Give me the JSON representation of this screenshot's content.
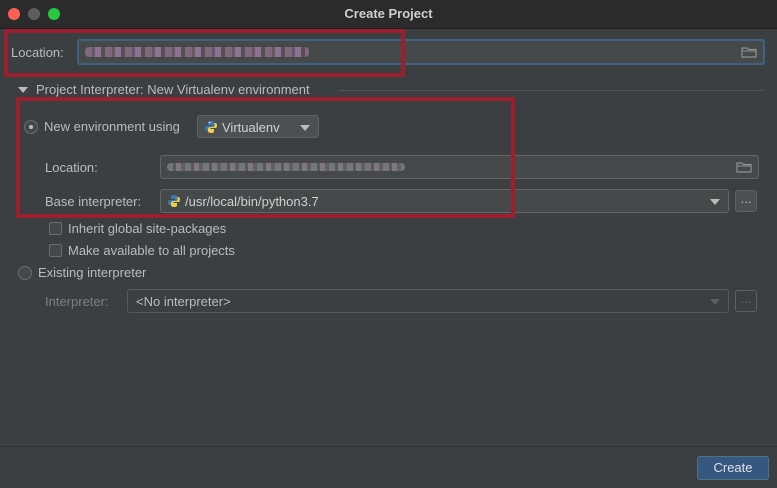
{
  "window": {
    "title": "Create Project"
  },
  "project": {
    "location_label": "Location:"
  },
  "interpreter_section": {
    "title": "Project Interpreter: New Virtualenv environment"
  },
  "new_env": {
    "radio_label": "New environment using",
    "tool": "Virtualenv",
    "location_label": "Location:",
    "base_interpreter_label": "Base interpreter:",
    "base_interpreter_value": "/usr/local/bin/python3.7",
    "browse_label": "...",
    "inherit_label": "Inherit global site-packages",
    "make_available_label": "Make available to all projects"
  },
  "existing": {
    "radio_label": "Existing interpreter",
    "interpreter_label": "Interpreter:",
    "interpreter_value": "<No interpreter>",
    "browse_label": "..."
  },
  "footer": {
    "create_label": "Create"
  },
  "colors": {
    "accent": "#3d6185",
    "highlight": "#9b1f2e",
    "primary_button": "#365880"
  },
  "icons": [
    "folder-icon",
    "python-icon",
    "chevron-down-icon",
    "expand-triangle-icon"
  ]
}
